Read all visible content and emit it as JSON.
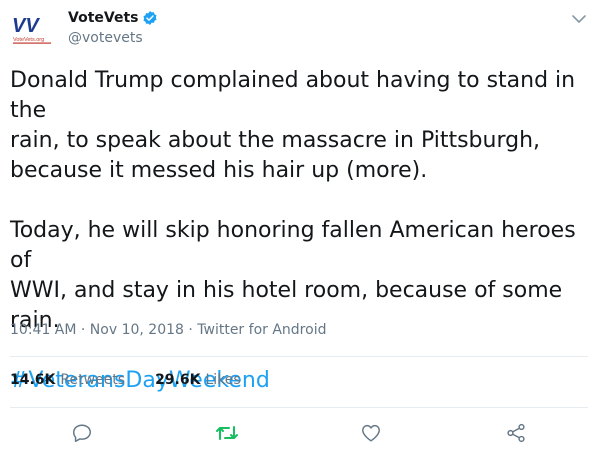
{
  "account": {
    "display_name": "VoteVets",
    "handle": "@votevets",
    "verified": true,
    "logo_letters": "VV",
    "logo_small": "VoteVets.org"
  },
  "tweet": {
    "paragraph_1": "Donald Trump complained about having to stand in the\nrain, to speak about the massacre in Pittsburgh,\nbecause it messed his hair up (more).",
    "paragraph_2": "Today, he will skip honoring fallen American heroes of\nWWI, and stay in his hotel room, because of some rain.",
    "hashtag": "#VeteransDayWeekend",
    "timestamp": "10:41 AM · Nov 10, 2018 · Twitter for Android"
  },
  "stats": {
    "retweets_count": "14.6K",
    "retweets_label": "Retweets",
    "likes_count": "29.6K",
    "likes_label": "Likes"
  },
  "icons": {
    "reply": "reply-icon",
    "retweet": "retweet-icon",
    "like": "heart-icon",
    "share": "share-icon",
    "menu": "chevron-down-icon",
    "verified": "verified-badge-icon"
  },
  "colors": {
    "text": "#14171a",
    "secondary": "#657786",
    "link": "#1da1f2",
    "retweet_active": "#17bf63",
    "brand_blue": "#1d3c8f",
    "divider": "#e6ecf0"
  }
}
